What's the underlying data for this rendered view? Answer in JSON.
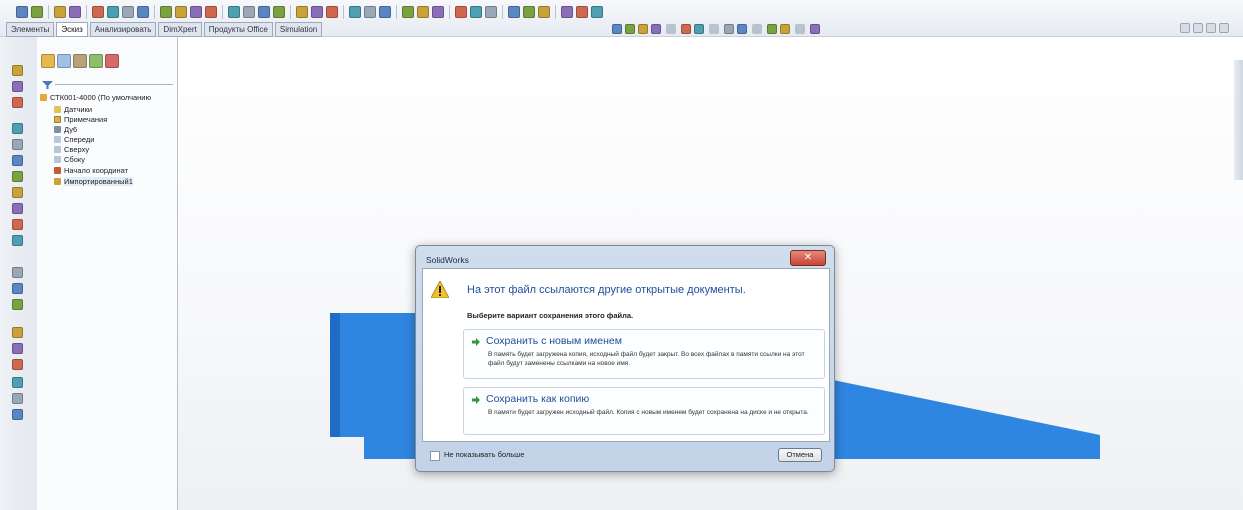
{
  "toolbar": {
    "tabs": [
      {
        "label": "Элементы",
        "active": false
      },
      {
        "label": "Эскиз",
        "active": true
      },
      {
        "label": "Анализировать",
        "active": false
      },
      {
        "label": "DimXpert",
        "active": false
      },
      {
        "label": "Продукты Office",
        "active": false
      },
      {
        "label": "Simulation",
        "active": false
      }
    ]
  },
  "tree": {
    "root": "СТК001-4000 (По умолчанию",
    "items": [
      {
        "label": "Датчики",
        "icon": "folder-icon"
      },
      {
        "label": "Примечания",
        "icon": "annotations-icon"
      },
      {
        "label": "Ду6",
        "icon": "material-icon"
      },
      {
        "label": "Спереди",
        "icon": "plane-icon"
      },
      {
        "label": "Сверху",
        "icon": "plane-icon"
      },
      {
        "label": "Сбоку",
        "icon": "plane-icon"
      },
      {
        "label": "Начало координат",
        "icon": "origin-icon"
      },
      {
        "label": "Импортированный1",
        "icon": "imported-body-icon"
      }
    ]
  },
  "colors": {
    "part": "#2f86e0",
    "part_dark": "#1f6cc4",
    "dialog_heading": "#1f4e9a",
    "close_button": "#c64535"
  },
  "dialog": {
    "title": "SolidWorks",
    "heading": "На этот файл ссылаются другие открытые документы.",
    "instruction": "Выберите вариант сохранения этого файла.",
    "options": [
      {
        "title": "Сохранить с новым именем",
        "description": "В память будет загружена копия, исходный файл будет закрыт. Во всех файлах в памяти ссылки на этот файл будут заменены ссылками на новое имя.",
        "icon": "green-arrow-icon"
      },
      {
        "title": "Сохранить как копию",
        "description": "В памяти будет загружен исходный файл. Копия с новым именем будет сохранена на диске и не открыта.",
        "icon": "green-arrow-icon"
      }
    ],
    "checkbox_label": "Не показывать больше",
    "checkbox_checked": false,
    "cancel_label": "Отмена"
  }
}
